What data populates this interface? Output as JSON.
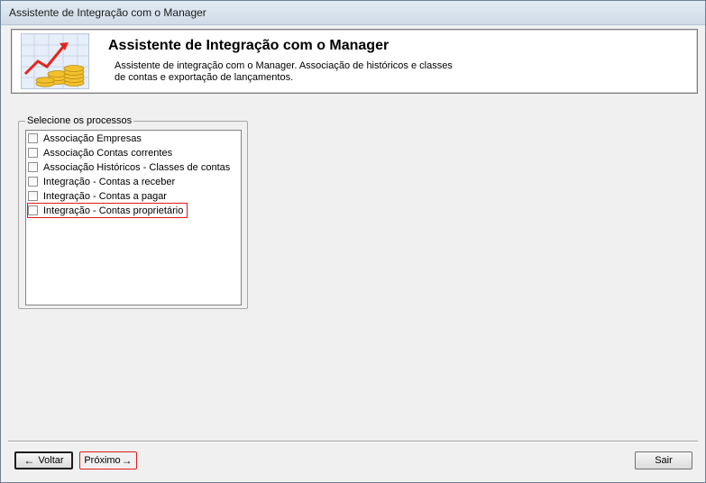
{
  "window": {
    "title": "Assistente de Integração com o Manager"
  },
  "header": {
    "title": "Assistente de Integração com o Manager",
    "description_line1": "Assistente de integração com o Manager. Associação de históricos e classes",
    "description_line2": "de contas e exportação de lançamentos."
  },
  "processes": {
    "legend": "Selecione os processos",
    "items": [
      {
        "label": "Associação Empresas",
        "checked": false
      },
      {
        "label": "Associação Contas correntes",
        "checked": false
      },
      {
        "label": "Associação Históricos - Classes de contas",
        "checked": false
      },
      {
        "label": "Integração - Contas a receber",
        "checked": false
      },
      {
        "label": "Integração - Contas a pagar",
        "checked": false
      },
      {
        "label": "Integração - Contas proprietário",
        "checked": false
      }
    ]
  },
  "footer": {
    "back_label": "Voltar",
    "next_label": "Próximo",
    "exit_label": "Sair"
  },
  "colors": {
    "highlight": "#e01b1b",
    "titlebar": "#dbe4ee"
  }
}
